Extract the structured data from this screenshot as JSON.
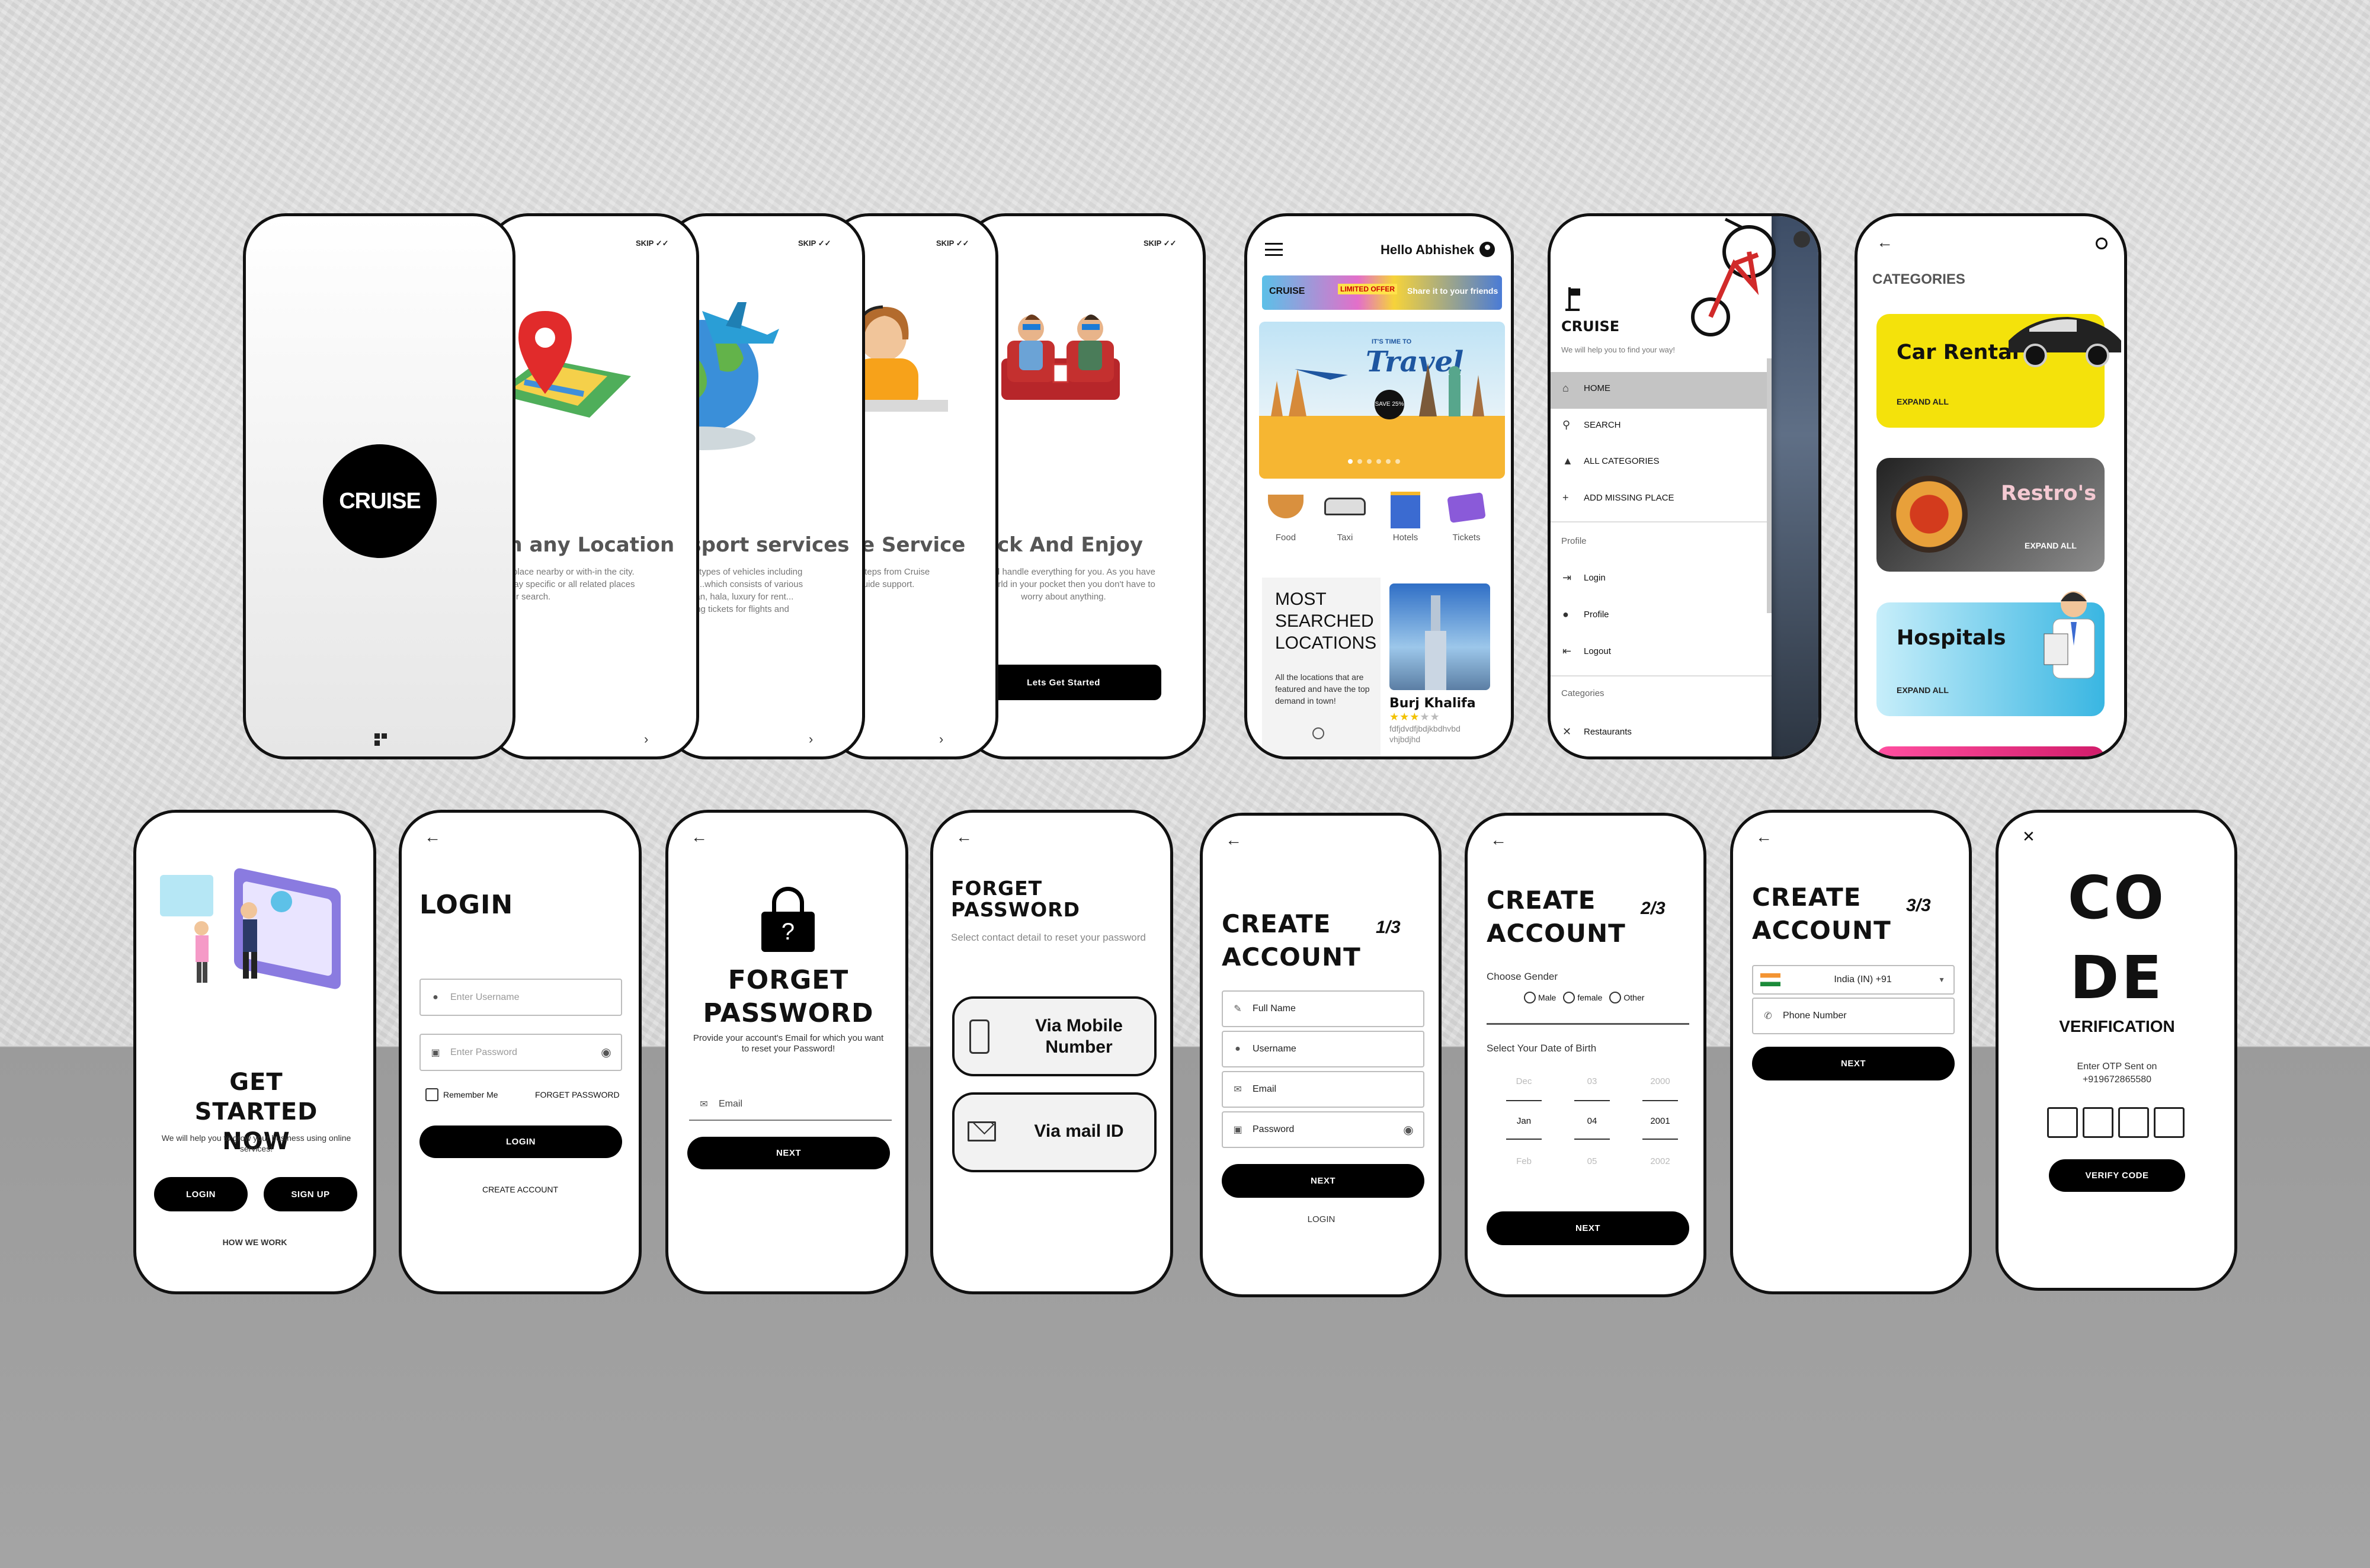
{
  "splash": {
    "logo": "CRUISE"
  },
  "onboarding": [
    {
      "skip": "SKIP",
      "title": "Search any Location",
      "text": "Search any place nearby or with-in the city. We will display specific or all related places to match your search."
    },
    {
      "skip": "SKIP",
      "title": "Transport services",
      "text": "Choose all types of vehicles including cars, bikes...which consists of various types: sedan, hala, luxury for rent... Also booking tickets for flights and trains"
    },
    {
      "skip": "SKIP",
      "title": "Guide Service",
      "text": "Just a simple steps from Cruise with the best guide support."
    },
    {
      "skip": "SKIP",
      "title": "Sit Back And Enjoy",
      "text": "We will handle everything for you. As you have the world in your pocket then you don't have to worry about anything.",
      "cta": "Lets Get Started"
    }
  ],
  "home": {
    "greeting": "Hello Abhishek",
    "promo_brand": "CRUISE",
    "promo_offer": "LIMITED OFFER",
    "promo_share": "Share it to your friends",
    "banner_small": "IT'S TIME TO",
    "banner_title": "Travel",
    "banner_badge": "SAVE 25%",
    "categories": [
      "Food",
      "Taxi",
      "Hotels",
      "Tickets"
    ],
    "most_searched_title": "MOST SEARCHED LOCATIONS",
    "most_searched_text": "All the locations that are featured and have the top demand in town!",
    "place_name": "Burj Khalifa",
    "place_sub": "fdfjdvdfjbdjkbdhvbd vhjbdjhd",
    "rating": 3
  },
  "drawer": {
    "brand": "CRUISE",
    "tagline": "We will help you to find your way!",
    "items": [
      "HOME",
      "SEARCH",
      "ALL CATEGORIES",
      "ADD MISSING PLACE"
    ],
    "profile_header": "Profile",
    "profile_items": [
      "Login",
      "Profile",
      "Logout"
    ],
    "categories_header": "Categories",
    "category_items": [
      "Restaurants"
    ]
  },
  "categories": {
    "title": "CATEGORIES",
    "cards": [
      {
        "name": "Car Rental",
        "action": "EXPAND ALL",
        "color": "#f4e20b"
      },
      {
        "name": "Restro's",
        "action": "EXPAND ALL",
        "color": "#555555"
      },
      {
        "name": "Hospitals",
        "action": "EXPAND ALL",
        "color": "#5ec6e6"
      }
    ]
  },
  "get_started": {
    "title": "GET STARTED NOW",
    "text": "We will help you to grow your business using online services!",
    "login": "LOGIN",
    "signup": "SIGN UP",
    "how": "HOW WE WORK"
  },
  "login": {
    "title": "LOGIN",
    "username_ph": "Enter Username",
    "password_ph": "Enter Password",
    "remember": "Remember Me",
    "forgot": "FORGET PASSWORD",
    "button": "LOGIN",
    "create": "CREATE ACCOUNT"
  },
  "forget1": {
    "title": "FORGET PASSWORD",
    "text": "Provide your account's Email for which you want to reset your Password!",
    "email_ph": "Email",
    "button": "NEXT"
  },
  "forget2": {
    "title": "FORGET PASSWORD",
    "text": "Select contact detail to reset your password",
    "opt1": "Via Mobile Number",
    "opt2": "Via mail ID"
  },
  "create1": {
    "title": "CREATE ACCOUNT",
    "step": "1/3",
    "full_name": "Full Name",
    "username": "Username",
    "email": "Email",
    "password": "Password",
    "button": "NEXT",
    "login": "LOGIN"
  },
  "create2": {
    "title": "CREATE ACCOUNT",
    "step": "2/3",
    "gender_label": "Choose Gender",
    "genders": [
      "Male",
      "female",
      "Other"
    ],
    "dob_label": "Select Your Date of Birth",
    "dob_rows": [
      [
        "Dec",
        "03",
        "2000"
      ],
      [
        "Jan",
        "04",
        "2001"
      ],
      [
        "Feb",
        "05",
        "2002"
      ]
    ],
    "button": "NEXT"
  },
  "create3": {
    "title": "CREATE ACCOUNT",
    "step": "3/3",
    "country": "India (IN)  +91",
    "phone_ph": "Phone Number",
    "button": "NEXT"
  },
  "verify": {
    "title_1": "CO",
    "title_2": "DE",
    "subtitle": "VERIFICATION",
    "text": "Enter OTP Sent on +919672865580",
    "button": "VERIFY CODE"
  }
}
